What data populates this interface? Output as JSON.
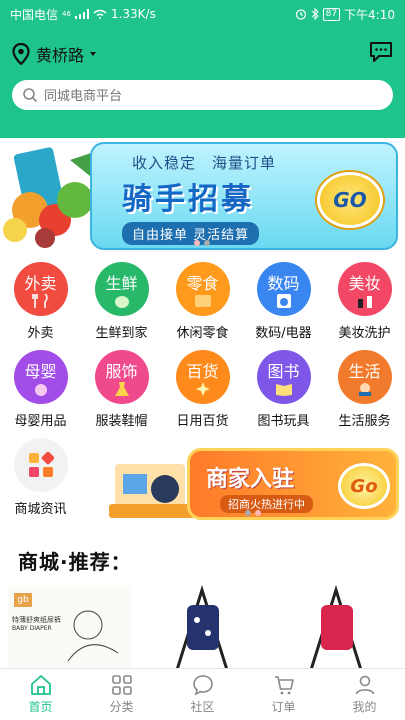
{
  "status_bar": {
    "carrier": "中国电信",
    "network": "46",
    "speed": "1.33K/s",
    "battery": "87",
    "time": "下午4:10"
  },
  "header": {
    "location": "黄桥路",
    "search_placeholder": "同城电商平台",
    "icons": [
      "location-pin-icon",
      "chevron-down-icon",
      "message-icon",
      "search-icon"
    ]
  },
  "banner": {
    "subtitle": "收入稳定　海量订单",
    "title": "骑手招募",
    "tag": "自由接单 灵活结算",
    "button": "GO",
    "page_count": 2,
    "active_page": 2
  },
  "categories": [
    {
      "icon_text": "外卖",
      "label": "外卖",
      "color": "#f24b40",
      "icon": "fork-knife-icon"
    },
    {
      "icon_text": "生鲜",
      "label": "生鲜到家",
      "color": "#28b86a",
      "icon": "cabbage-icon"
    },
    {
      "icon_text": "零食",
      "label": "休闲零食",
      "color": "#ff9a1c",
      "icon": "snack-bag-icon"
    },
    {
      "icon_text": "数码",
      "label": "数码/电器",
      "color": "#3a86f0",
      "icon": "washing-machine-icon"
    },
    {
      "icon_text": "美妆",
      "label": "美妆洗护",
      "color": "#f24765",
      "icon": "lipstick-icon"
    },
    {
      "icon_text": "母婴",
      "label": "母婴用品",
      "color": "#a24de8",
      "icon": "baby-icon"
    },
    {
      "icon_text": "服饰",
      "label": "服装鞋帽",
      "color": "#ef4a8c",
      "icon": "dress-icon"
    },
    {
      "icon_text": "百货",
      "label": "日用百货",
      "color": "#ff8a1c",
      "icon": "sparkle-icon"
    },
    {
      "icon_text": "图书",
      "label": "图书玩具",
      "color": "#7e56e8",
      "icon": "book-icon"
    },
    {
      "icon_text": "生活",
      "label": "生活服务",
      "color": "#f27a2c",
      "icon": "worker-icon"
    },
    {
      "icon_text": "",
      "label": "商城资讯",
      "color": "#f2f2f2",
      "icon": "grid-apps-icon"
    }
  ],
  "promo": {
    "title": "商家入驻",
    "subtitle": "招商火热进行中",
    "button": "Go",
    "page_count": 2,
    "active_page": 1
  },
  "section": {
    "title": "商城·推荐："
  },
  "products": [
    {
      "brand": "gb",
      "text": "特薄舒爽纸尿裤",
      "caption": "BABY DIAPER"
    },
    {
      "brand": "",
      "text": "",
      "caption": ""
    },
    {
      "brand": "",
      "text": "",
      "caption": ""
    }
  ],
  "tabbar": [
    {
      "label": "首页",
      "icon": "home-icon",
      "active": true
    },
    {
      "label": "分类",
      "icon": "category-grid-icon",
      "active": false
    },
    {
      "label": "社区",
      "icon": "chat-bubble-icon",
      "active": false
    },
    {
      "label": "订单",
      "icon": "cart-icon",
      "active": false
    },
    {
      "label": "我的",
      "icon": "user-icon",
      "active": false
    }
  ],
  "colors": {
    "brand": "#1fc48a",
    "banner_blue": "#1567c5",
    "promo_orange": "#ff7a29"
  }
}
